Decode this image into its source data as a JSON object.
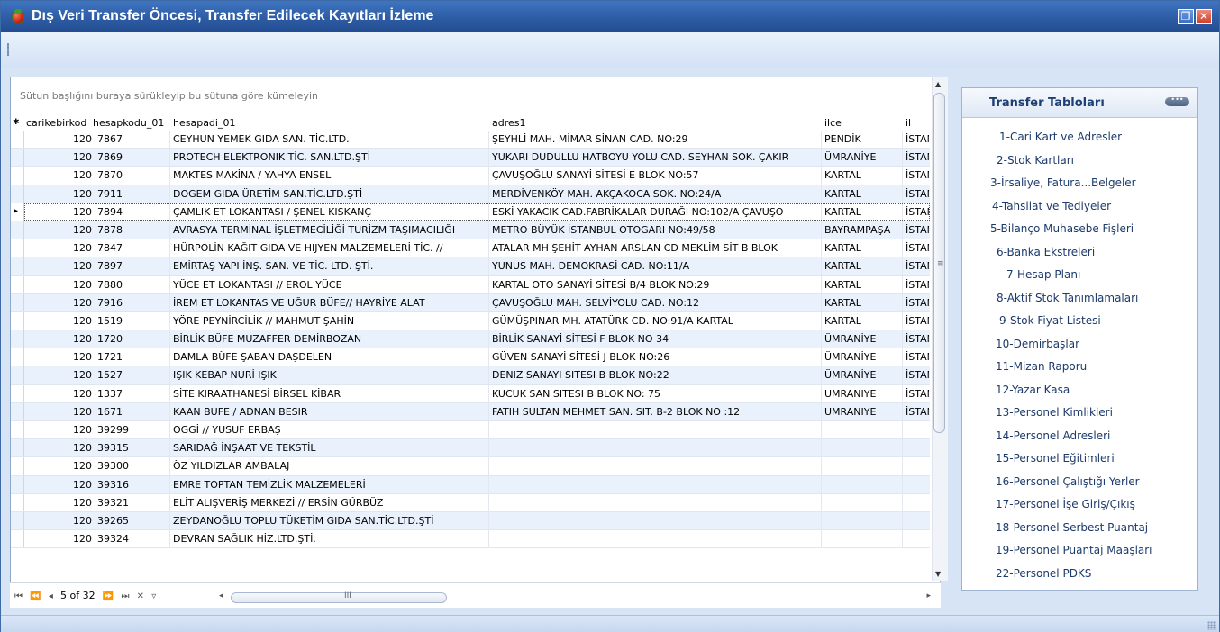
{
  "window": {
    "title": "Dış Veri Transfer Öncesi, Transfer Edilecek Kayıtları İzleme",
    "restore_glyph": "❐",
    "close_glyph": "✕"
  },
  "grid": {
    "group_panel_text": "Sütun başlığını buraya sürükleyip bu sütuna göre kümeleyin",
    "columns": [
      "carikebirkod",
      "hesapkodu_01",
      "hesapadi_01",
      "adres1",
      "ilce",
      "il"
    ],
    "new_row_marker": "✱",
    "rows": [
      [
        "120",
        "7867",
        "CEYHUN YEMEK GIDA SAN. TİC.LTD.",
        "ŞEYHLİ MAH. MİMAR SİNAN CAD. NO:29",
        "PENDİK",
        "İSTAN"
      ],
      [
        "120",
        "7869",
        "PROTECH ELEKTRONIK TİC. SAN.LTD.ŞTİ",
        "YUKARI DUDULLU HATBOYU YOLU CAD. SEYHAN SOK. ÇAKIR",
        "ÜMRANİYE",
        "İSTAN"
      ],
      [
        "120",
        "7870",
        "MAKTES MAKİNA / YAHYA ENSEL",
        "ÇAVUŞOĞLU SANAYİ SİTESİ E BLOK NO:57",
        "KARTAL",
        "İSTAN"
      ],
      [
        "120",
        "7911",
        "DOGEM GIDA ÜRETİM SAN.TİC.LTD.ŞTİ",
        "MERDİVENKÖY MAH. AKÇAKOCA SOK. NO:24/A",
        "KARTAL",
        "İSTAN"
      ],
      [
        "120",
        "7894",
        "ÇAMLIK ET LOKANTASI / ŞENEL KISKANÇ",
        "ESKİ YAKACIK CAD.FABRİKALAR DURAĞI NO:102/A ÇAVUŞO",
        "KARTAL",
        "İSTAN"
      ],
      [
        "120",
        "7878",
        "AVRASYA TERMİNAL İŞLETMECİLİĞİ TURİZM TAŞIMACILIĞI",
        "METRO BÜYÜK İSTANBUL OTOGARI NO:49/58",
        "BAYRAMPAŞA",
        "İSTAN"
      ],
      [
        "120",
        "7847",
        "HÜRPOLİN KAĞIT GIDA VE HIJYEN MALZEMELERİ TİC. //",
        "ATALAR MH ŞEHİT AYHAN ARSLAN CD MEKLİM SİT B BLOK",
        "KARTAL",
        "İSTAN"
      ],
      [
        "120",
        "7897",
        "EMİRTAŞ YAPI İNŞ. SAN. VE TİC. LTD. ŞTİ.",
        "YUNUS MAH. DEMOKRASİ CAD. NO:11/A",
        "KARTAL",
        "İSTAN"
      ],
      [
        "120",
        "7880",
        "YÜCE ET LOKANTASI // EROL YÜCE",
        "KARTAL OTO SANAYİ SİTESİ B/4 BLOK NO:29",
        "KARTAL",
        "İSTAN"
      ],
      [
        "120",
        "7916",
        "İREM ET LOKANTAS VE UĞUR BÜFE// HAYRİYE ALAT",
        "ÇAVUŞOĞLU MAH. SELVİYOLU CAD. NO:12",
        "KARTAL",
        "İSTAN"
      ],
      [
        "120",
        "1519",
        "YÖRE PEYNİRCİLİK // MAHMUT ŞAHİN",
        "GÜMÜŞPINAR MH. ATATÜRK CD. NO:91/A KARTAL",
        "KARTAL",
        "İSTAN"
      ],
      [
        "120",
        "1720",
        "BİRLİK BÜFE MUZAFFER DEMİRBOZAN",
        "BİRLİK SANAYİ SİTESİ F BLOK NO 34",
        "ÜMRANİYE",
        "İSTAN"
      ],
      [
        "120",
        "1721",
        "DAMLA BÜFE ŞABAN DAŞDELEN",
        "GÜVEN SANAYİ SİTESİ J BLOK NO:26",
        "ÜMRANİYE",
        "İSTAN"
      ],
      [
        "120",
        "1527",
        "IŞIK KEBAP NURİ IŞIK",
        "DENIZ SANAYI SITESI B BLOK NO:22",
        "ÜMRANİYE",
        "İSTAN"
      ],
      [
        "120",
        "1337",
        "SİTE KIRAATHANESİ BİRSEL KİBAR",
        "KUCUK SAN SITESI B BLOK NO: 75",
        "UMRANIYE",
        "İSTAN"
      ],
      [
        "120",
        "1671",
        "KAAN BUFE / ADNAN BESIR",
        "FATIH SULTAN MEHMET SAN. SIT. B-2 BLOK NO :12",
        "UMRANIYE",
        "İSTAN"
      ],
      [
        "120",
        "39299",
        "OGGİ // YUSUF ERBAŞ",
        "",
        "",
        ""
      ],
      [
        "120",
        "39315",
        "SARIDAĞ İNŞAAT VE TEKSTİL",
        "",
        "",
        ""
      ],
      [
        "120",
        "39300",
        "ÖZ YILDIZLAR AMBALAJ",
        "",
        "",
        ""
      ],
      [
        "120",
        "39316",
        "EMRE TOPTAN TEMİZLİK MALZEMELERİ",
        "",
        "",
        ""
      ],
      [
        "120",
        "39321",
        "ELİT ALIŞVERİŞ MERKEZİ // ERSİN GÜRBÜZ",
        "",
        "",
        ""
      ],
      [
        "120",
        "39265",
        "ZEYDANOĞLU TOPLU TÜKETİM GIDA SAN.TİC.LTD.ŞTİ",
        "",
        "",
        ""
      ],
      [
        "120",
        "39324",
        "DEVRAN SAĞLIK HİZ.LTD.ŞTİ.",
        "",
        "",
        ""
      ]
    ],
    "selected_row": 4
  },
  "navigator": {
    "first": "⏮",
    "prev_page": "⏪",
    "prev": "◂",
    "position": "5 of 32",
    "next": "⏩",
    "next_page": "⏭",
    "delete": "✕",
    "filter": "▿"
  },
  "scroll": {
    "up": "▲",
    "down": "▼",
    "left": "◂",
    "right": "▸",
    "grip_v": "≡",
    "grip_h": "III"
  },
  "sidebar": {
    "title": "Transfer Tabloları",
    "menu_glyph": "•••",
    "items": [
      "1-Cari Kart ve Adresler",
      "2-Stok Kartları",
      "3-İrsaliye, Fatura...Belgeler",
      "4-Tahsilat ve Tediyeler",
      "5-Bilanço Muhasebe Fişleri",
      "6-Banka Ekstreleri",
      "7-Hesap Planı",
      "8-Aktif Stok Tanımlamaları",
      "9-Stok Fiyat Listesi",
      "10-Demirbaşlar",
      "11-Mizan Raporu",
      "12-Yazar Kasa",
      "13-Personel Kimlikleri",
      "14-Personel Adresleri",
      "15-Personel Eğitimleri",
      "16-Personel Çalıştığı Yerler",
      "17-Personel İşe Giriş/Çıkış",
      "18-Personel Serbest Puantaj",
      "19-Personel Puantaj Maaşları",
      "22-Personel PDKS"
    ]
  }
}
